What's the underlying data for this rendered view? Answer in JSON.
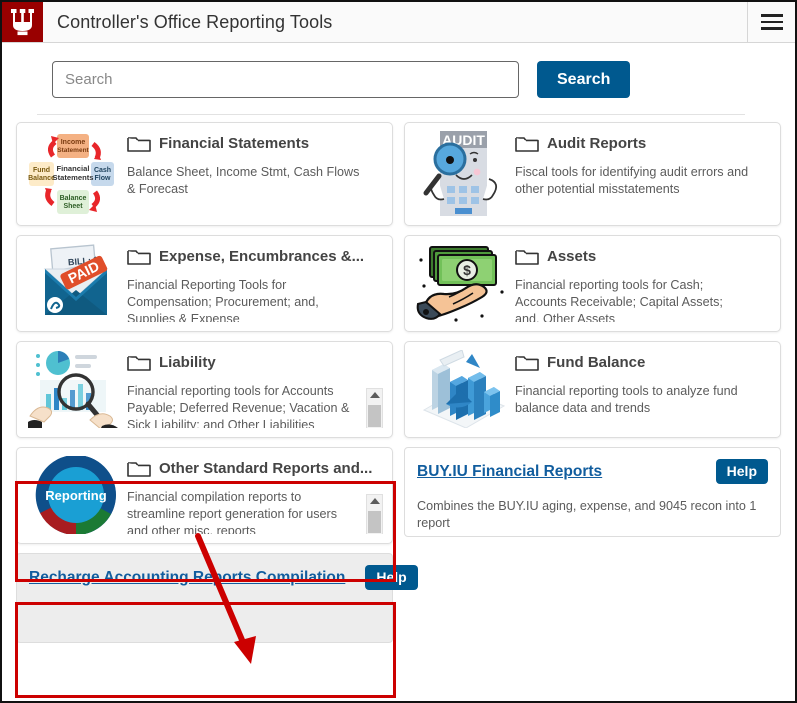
{
  "header": {
    "logo_alt": "Indiana University trident logo",
    "title": "Controller's Office Reporting Tools",
    "menu_icon": "hamburger-menu-icon",
    "logo_bg": "#990000"
  },
  "search": {
    "placeholder": "Search",
    "value": "",
    "button_label": "Search",
    "button_color": "#00598f"
  },
  "cards": [
    {
      "title": "Financial Statements",
      "description": "Balance Sheet, Income Stmt, Cash Flows & Forecast",
      "icon": "financial-statements-cycle-icon",
      "scrollable": false
    },
    {
      "title": "Audit Reports",
      "description": "Fiscal tools for identifying audit errors and other potential misstatements",
      "icon": "audit-calculator-magnifier-icon",
      "scrollable": false
    },
    {
      "title": "Expense, Encumbrances &...",
      "description": "Financial Reporting Tools for Compensation; Procurement; and, Supplies & Expense",
      "icon": "paid-bill-envelope-icon",
      "scrollable": false
    },
    {
      "title": "Assets",
      "description": "Financial reporting tools for Cash; Accounts Receivable; Capital Assets; and, Other Assets",
      "icon": "hand-holding-cash-icon",
      "scrollable": false
    },
    {
      "title": "Liability",
      "description": "Financial reporting tools for Accounts Payable; Deferred Revenue; Vacation & Sick Liability; and Other Liabilities",
      "icon": "chart-magnifier-analysis-icon",
      "scrollable": true
    },
    {
      "title": "Fund Balance",
      "description": "Financial reporting tools to analyze fund balance data and trends",
      "icon": "3d-bar-chart-icon",
      "scrollable": false
    },
    {
      "title": "Other Standard Reports and...",
      "description": "Financial compilation reports to streamline report generation for users and other misc. reports",
      "icon": "reporting-donut-chart-icon",
      "scrollable": true,
      "highlighted": true
    }
  ],
  "link_cards": [
    {
      "title": "BUY.IU Financial Reports",
      "help_label": "Help",
      "description": "Combines the BUY.IU aging, expense, and 9045 recon into 1 report",
      "background": "#ffffff",
      "highlighted": true
    },
    {
      "title": "Recharge Accounting Reports Compilation",
      "help_label": "Help",
      "description": "",
      "background": "#ededed",
      "highlighted": false
    }
  ],
  "annotations": {
    "color": "#cc0000",
    "arrow_from": "Other Standard Reports card",
    "arrow_to": "BUY.IU Financial Reports card"
  },
  "icon_text": {
    "fin_stmt_center": "Financial Statements",
    "fin_stmt_top": "Income Statement",
    "fin_stmt_right": "Cash Flow",
    "fin_stmt_bottom": "Balance Sheet",
    "fin_stmt_left": "Fund Balance",
    "audit_label": "AUDIT",
    "bill_label": "BILL: $",
    "paid_label": "PAID",
    "dollar_sign": "$",
    "donut_label": "Reporting"
  }
}
